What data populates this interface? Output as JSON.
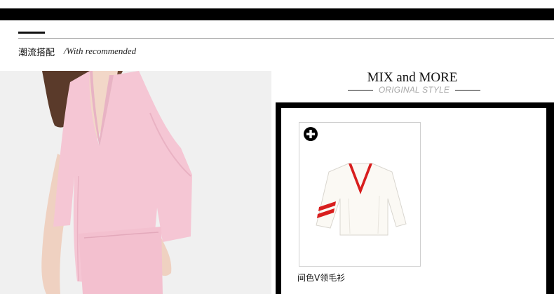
{
  "section": {
    "title": "潮流搭配",
    "subtitle": "/With recommended"
  },
  "mix": {
    "title": "MIX and MORE",
    "subtitle": "ORIGINAL STYLE"
  },
  "product": {
    "name": "间色V领毛衫"
  },
  "icons": {
    "add": "plus-circle-icon"
  },
  "colors": {
    "accent_red": "#d81e1e",
    "pink_outfit": "#f1c3d2",
    "frame": "#000000"
  }
}
